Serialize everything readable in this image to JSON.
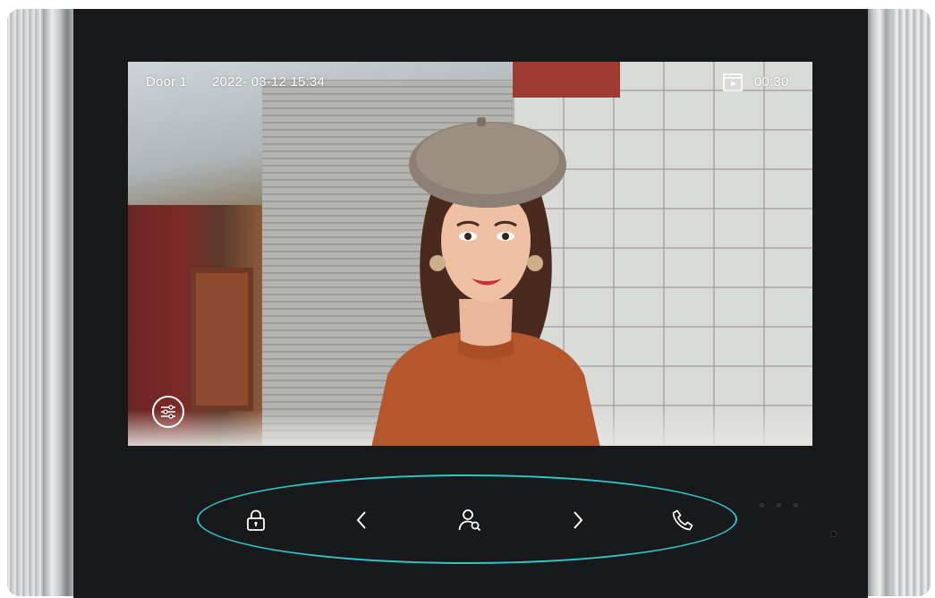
{
  "osd": {
    "door_label": "Door 1",
    "datetime": "2022- 03-12 15:34",
    "timer": "00:30",
    "record_icon": "video-clip-icon"
  },
  "screen_buttons": {
    "settings_icon": "sliders-settings-icon"
  },
  "touch_keys": [
    {
      "name": "unlock-button",
      "icon": "lock-icon"
    },
    {
      "name": "previous-button",
      "icon": "chevron-left-icon"
    },
    {
      "name": "monitor-button",
      "icon": "user-search-icon"
    },
    {
      "name": "next-button",
      "icon": "chevron-right-icon"
    },
    {
      "name": "call-button",
      "icon": "phone-icon"
    }
  ],
  "colors": {
    "panel": "#18191b",
    "accent_ring": "#2fc6c9",
    "icon": "#ffffff"
  }
}
